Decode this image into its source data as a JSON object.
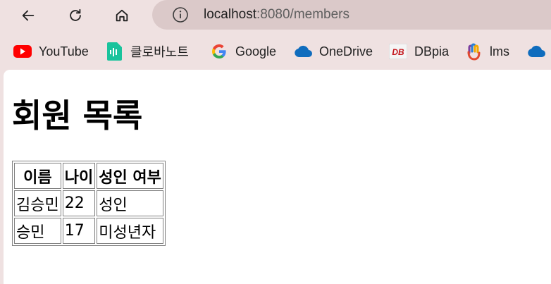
{
  "browser": {
    "url_host": "localhost",
    "url_path": ":8080/members",
    "bookmarks": [
      {
        "label": "YouTube",
        "icon": "youtube-icon"
      },
      {
        "label": "클로바노트",
        "icon": "clova-note-icon"
      },
      {
        "label": "Google",
        "icon": "google-icon"
      },
      {
        "label": "OneDrive",
        "icon": "onedrive-icon"
      },
      {
        "label": "DBpia",
        "icon": "dbpia-icon"
      },
      {
        "label": "lms",
        "icon": "lms-icon"
      }
    ]
  },
  "page": {
    "title": "회원 목록",
    "table": {
      "headers": [
        "이름",
        "나이",
        "성인 여부"
      ],
      "rows": [
        [
          "김승민",
          "22",
          "성인"
        ],
        [
          "승민",
          "17",
          "미성년자"
        ]
      ]
    }
  }
}
